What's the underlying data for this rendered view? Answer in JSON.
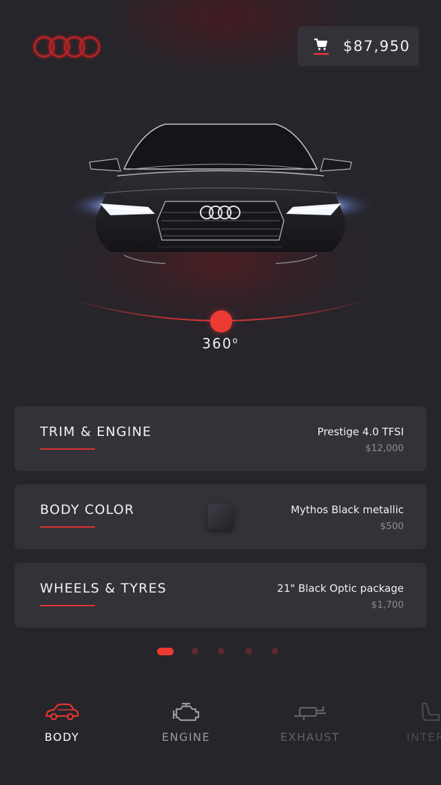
{
  "header": {
    "brand_icon": "audi-rings-logo",
    "cart_icon": "cart-icon",
    "cart_total": "$87,950"
  },
  "viewer": {
    "rotation_label": "360",
    "rotation_unit": "o"
  },
  "options": [
    {
      "title": "TRIM & ENGINE",
      "value": "Prestige 4.0 TFSI",
      "price": "$12,000"
    },
    {
      "title": "BODY COLOR",
      "value": "Mythos Black metallic",
      "price": "$500",
      "swatch_color": "#2a292f"
    },
    {
      "title": "WHEELS & TYRES",
      "value": "21\" Black Optic package",
      "price": "$1,700"
    }
  ],
  "pager": {
    "count": 5,
    "active_index": 0
  },
  "tabs": [
    {
      "label": "BODY",
      "icon": "car-icon",
      "active": true
    },
    {
      "label": "ENGINE",
      "icon": "engine-icon",
      "active": false
    },
    {
      "label": "EXHAUST",
      "icon": "exhaust-icon",
      "active": false
    },
    {
      "label": "INTER",
      "icon": "seat-icon",
      "active": false
    }
  ],
  "colors": {
    "background": "#26252b",
    "card": "#333239",
    "accent": "#ee3a34",
    "muted_text": "#8e8d95"
  }
}
